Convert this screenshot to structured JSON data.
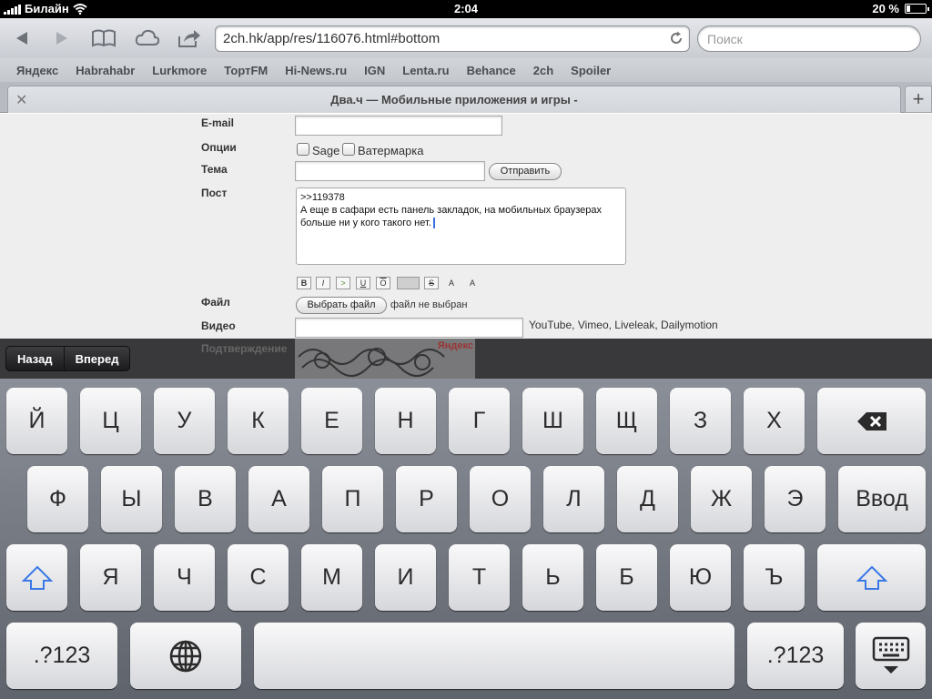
{
  "status": {
    "carrier": "Билайн",
    "time": "2:04",
    "battery": "20 %",
    "battery_level": 0.2
  },
  "toolbar": {
    "url": "2ch.hk/app/res/116076.html#bottom",
    "search_placeholder": "Поиск"
  },
  "bookmarks": [
    "Яндекс",
    "Habrahabr",
    "Lurkmore",
    "ТортFM",
    "Hi-News.ru",
    "IGN",
    "Lenta.ru",
    "Behance",
    "2ch",
    "Spoiler"
  ],
  "tab": {
    "title": "Два.ч — Мобильные приложения и игры -"
  },
  "form": {
    "email_label": "E-mail",
    "options_label": "Опции",
    "sage_label": "Sage",
    "watermark_label": "Ватермарка",
    "subject_label": "Тема",
    "submit_label": "Отправить",
    "post_label": "Пост",
    "post_line1": ">>119378",
    "post_line2": "А еще в сафари есть панель закладок, на мобильных браузерах",
    "post_line3": "больше ни у кого такого нет.",
    "format_buttons": [
      "B",
      "I",
      ">",
      "U",
      "O",
      "",
      "S",
      "A",
      "A"
    ],
    "file_label": "Файл",
    "choose_file_label": "Выбрать файл",
    "no_file_label": "файл не выбран",
    "video_label": "Видео",
    "video_hint": "YouTube, Vimeo, Liveleak, Dailymotion",
    "captcha_label": "Подтверждение",
    "captcha_brand": "Яндекс"
  },
  "assistant": {
    "back_label": "Назад",
    "forward_label": "Вперед"
  },
  "keyboard": {
    "row1": [
      "Й",
      "Ц",
      "У",
      "К",
      "Е",
      "Н",
      "Г",
      "Ш",
      "Щ",
      "З",
      "Х"
    ],
    "row2": [
      "Ф",
      "Ы",
      "В",
      "А",
      "П",
      "Р",
      "О",
      "Л",
      "Д",
      "Ж",
      "Э"
    ],
    "enter_label": "Ввод",
    "row3": [
      "Я",
      "Ч",
      "С",
      "М",
      "И",
      "Т",
      "Ь",
      "Б",
      "Ю",
      "Ъ"
    ],
    "numbers_label": ".?123",
    "accent_color": "#3a78e6"
  }
}
